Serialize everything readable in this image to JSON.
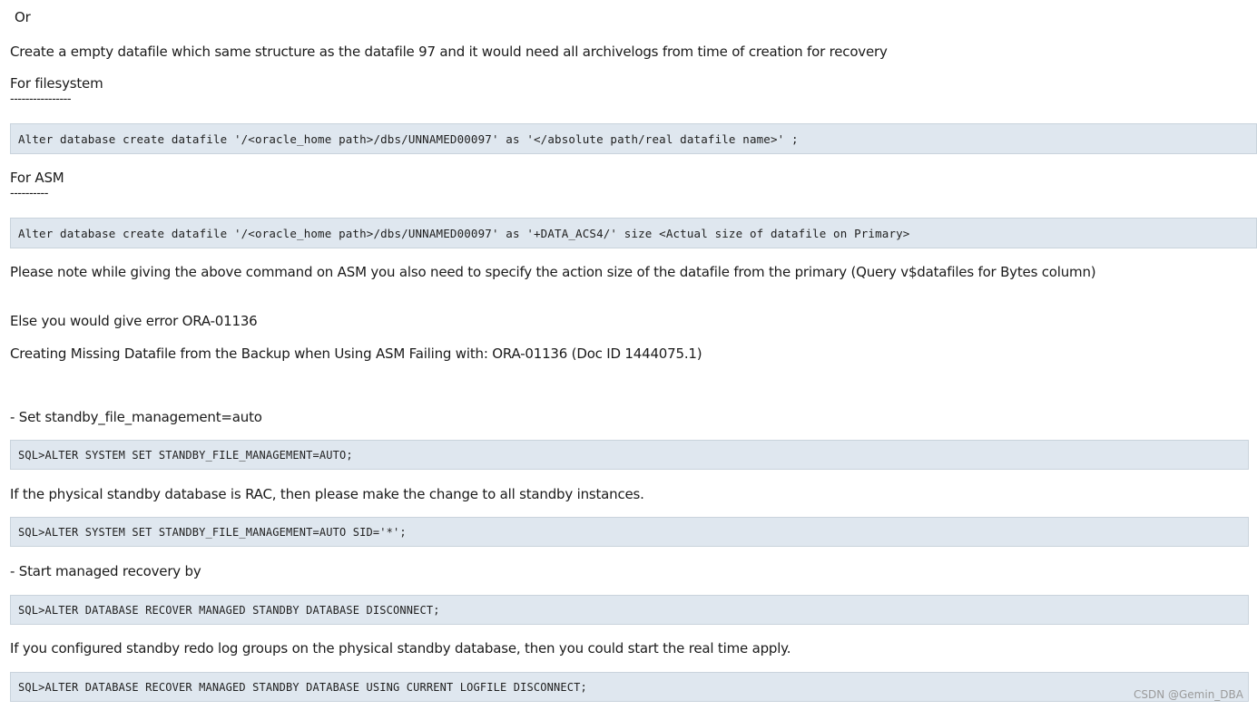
{
  "lines": {
    "or": "Or",
    "create_empty": "Create a empty datafile which same structure as the datafile 97 and it would need all archivelogs from time of creation for recovery",
    "for_filesystem": "For filesystem",
    "dash_filesystem": "----------------",
    "code_filesystem": "Alter database create datafile '/<oracle_home path>/dbs/UNNAMED00097' as '</absolute path/real datafile name>' ;",
    "for_asm": "For ASM",
    "dash_asm": "----------",
    "code_asm": "Alter database create datafile '/<oracle_home path>/dbs/UNNAMED00097' as '+DATA_ACS4/' size <Actual size of datafile on Primary>",
    "note_asm": "Please note while giving the above command on ASM you also need to specify the action size of the datafile from the primary (Query v$datafiles for Bytes column)",
    "else_error": "Else you would give error ORA-01136",
    "doc_ref": "Creating Missing Datafile from the Backup when Using ASM Failing with: ORA-01136 (Doc ID 1444075.1)",
    "set_standby": "- Set standby_file_management=auto",
    "code_set_auto": "SQL>ALTER SYSTEM SET STANDBY_FILE_MANAGEMENT=AUTO;",
    "rac_note": "If the physical standby database is RAC, then please make the change to all standby instances.",
    "code_set_auto_sid": "SQL>ALTER SYSTEM SET STANDBY_FILE_MANAGEMENT=AUTO SID='*';",
    "start_recovery": "- Start managed recovery by",
    "code_recover": "SQL>ALTER DATABASE RECOVER MANAGED STANDBY DATABASE DISCONNECT;",
    "redo_note": "If you configured standby redo log groups on the physical standby database, then you could start the real time apply.",
    "code_recover_current": "SQL>ALTER DATABASE RECOVER MANAGED STANDBY DATABASE USING CURRENT LOGFILE DISCONNECT;"
  },
  "watermark": "CSDN @Gemin_DBA"
}
